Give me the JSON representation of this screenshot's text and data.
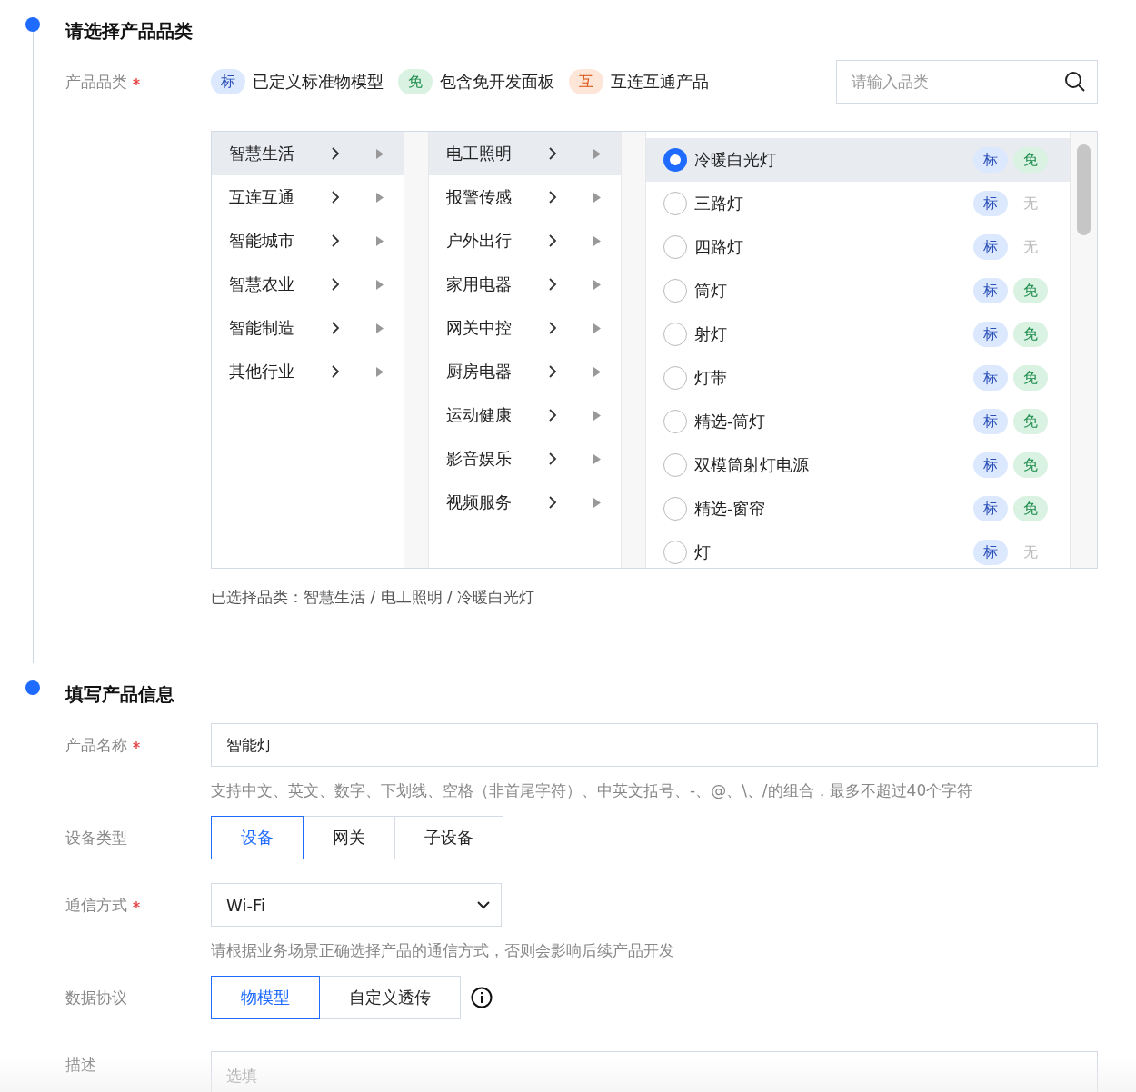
{
  "section_1": {
    "title": "请选择产品品类",
    "category_label": "产品品类",
    "required": true,
    "legend": [
      {
        "kind": "standard",
        "tag": "标",
        "text": "已定义标准物模型"
      },
      {
        "kind": "free",
        "tag": "免",
        "text": "包含免开发面板"
      },
      {
        "kind": "interop",
        "tag": "互",
        "text": "互连互通产品"
      }
    ],
    "search": {
      "placeholder": "请输入品类"
    },
    "cascader": {
      "column_1": [
        {
          "label": "智慧生活",
          "selected": true
        },
        {
          "label": "互连互通",
          "selected": false
        },
        {
          "label": "智能城市",
          "selected": false
        },
        {
          "label": "智慧农业",
          "selected": false
        },
        {
          "label": "智能制造",
          "selected": false
        },
        {
          "label": "其他行业",
          "selected": false
        }
      ],
      "column_2": [
        {
          "label": "电工照明",
          "selected": true
        },
        {
          "label": "报警传感",
          "selected": false
        },
        {
          "label": "户外出行",
          "selected": false
        },
        {
          "label": "家用电器",
          "selected": false
        },
        {
          "label": "网关中控",
          "selected": false
        },
        {
          "label": "厨房电器",
          "selected": false
        },
        {
          "label": "运动健康",
          "selected": false
        },
        {
          "label": "影音娱乐",
          "selected": false
        },
        {
          "label": "视频服务",
          "selected": false
        }
      ],
      "column_3": [
        {
          "label": "冷暖白光灯",
          "selected": true,
          "tags": [
            {
              "kind": "standard",
              "text": "标"
            },
            {
              "kind": "free",
              "text": "免"
            }
          ]
        },
        {
          "label": "三路灯",
          "selected": false,
          "tags": [
            {
              "kind": "standard",
              "text": "标"
            },
            {
              "kind": "none",
              "text": "无"
            }
          ]
        },
        {
          "label": "四路灯",
          "selected": false,
          "tags": [
            {
              "kind": "standard",
              "text": "标"
            },
            {
              "kind": "none",
              "text": "无"
            }
          ]
        },
        {
          "label": "筒灯",
          "selected": false,
          "tags": [
            {
              "kind": "standard",
              "text": "标"
            },
            {
              "kind": "free",
              "text": "免"
            }
          ]
        },
        {
          "label": "射灯",
          "selected": false,
          "tags": [
            {
              "kind": "standard",
              "text": "标"
            },
            {
              "kind": "free",
              "text": "免"
            }
          ]
        },
        {
          "label": "灯带",
          "selected": false,
          "tags": [
            {
              "kind": "standard",
              "text": "标"
            },
            {
              "kind": "free",
              "text": "免"
            }
          ]
        },
        {
          "label": "精选-筒灯",
          "selected": false,
          "tags": [
            {
              "kind": "standard",
              "text": "标"
            },
            {
              "kind": "free",
              "text": "免"
            }
          ]
        },
        {
          "label": "双模筒射灯电源",
          "selected": false,
          "tags": [
            {
              "kind": "standard",
              "text": "标"
            },
            {
              "kind": "free",
              "text": "免"
            }
          ]
        },
        {
          "label": "精选-窗帘",
          "selected": false,
          "tags": [
            {
              "kind": "standard",
              "text": "标"
            },
            {
              "kind": "free",
              "text": "免"
            }
          ]
        },
        {
          "label": "灯",
          "selected": false,
          "tags": [
            {
              "kind": "standard",
              "text": "标"
            },
            {
              "kind": "none",
              "text": "无"
            }
          ]
        }
      ]
    },
    "selected_path": "已选择品类：智慧生活 / 电工照明 / 冷暖白光灯"
  },
  "section_2": {
    "title": "填写产品信息",
    "product_name": {
      "label": "产品名称",
      "required": true,
      "value": "智能灯",
      "hint": "支持中文、英文、数字、下划线、空格（非首尾字符）、中英文括号、-、@、\\、/的组合，最多不超过40个字符"
    },
    "device_type": {
      "label": "设备类型",
      "options": [
        {
          "label": "设备",
          "selected": true
        },
        {
          "label": "网关",
          "selected": false
        },
        {
          "label": "子设备",
          "selected": false
        }
      ]
    },
    "communication": {
      "label": "通信方式",
      "required": true,
      "value": "Wi-Fi",
      "hint": "请根据业务场景正确选择产品的通信方式，否则会影响后续产品开发"
    },
    "data_protocol": {
      "label": "数据协议",
      "options": [
        {
          "label": "物模型",
          "selected": true
        },
        {
          "label": "自定义透传",
          "selected": false
        }
      ]
    },
    "description": {
      "label": "描述",
      "placeholder": "选填"
    }
  }
}
